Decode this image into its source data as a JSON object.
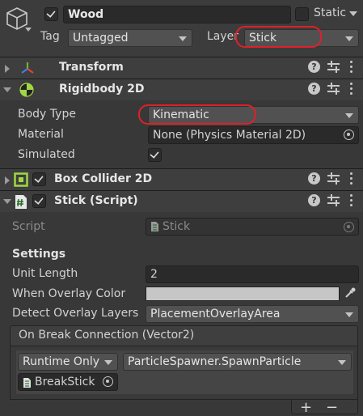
{
  "header": {
    "name_value": "Wood",
    "static_label": "Static",
    "tag_label": "Tag",
    "tag_value": "Untagged",
    "layer_label": "Layer",
    "layer_value": "Stick"
  },
  "components": {
    "transform": {
      "title": "Transform"
    },
    "rigidbody": {
      "title": "Rigidbody 2D",
      "body_type_label": "Body Type",
      "body_type_value": "Kinematic",
      "material_label": "Material",
      "material_value": "None (Physics Material 2D)",
      "simulated_label": "Simulated"
    },
    "box_collider": {
      "title": "Box Collider 2D"
    },
    "stick_script": {
      "title": "Stick (Script)",
      "script_label": "Script",
      "script_value": "Stick",
      "settings_header": "Settings",
      "unit_length_label": "Unit Length",
      "unit_length_value": "2",
      "overlay_color_label": "When Overlay Color",
      "detect_layers_label": "Detect Overlay Layers",
      "detect_layers_value": "PlacementOverlayArea",
      "event_title": "On Break Connection (Vector2)",
      "runtime_value": "Runtime Only",
      "function_value": "ParticleSpawner.SpawnParticle",
      "target_object": "BreakStick",
      "add_label": "+",
      "remove_label": "−"
    }
  },
  "icons": {
    "gameobject": "cube-icon",
    "transform": "transform-axes-icon",
    "rigidbody": "rigidbody-icon",
    "collider": "box-collider-icon",
    "script": "script-hash-icon"
  },
  "colors": {
    "highlight": "#e0202a",
    "overlay_color": "#c6c6c6"
  }
}
